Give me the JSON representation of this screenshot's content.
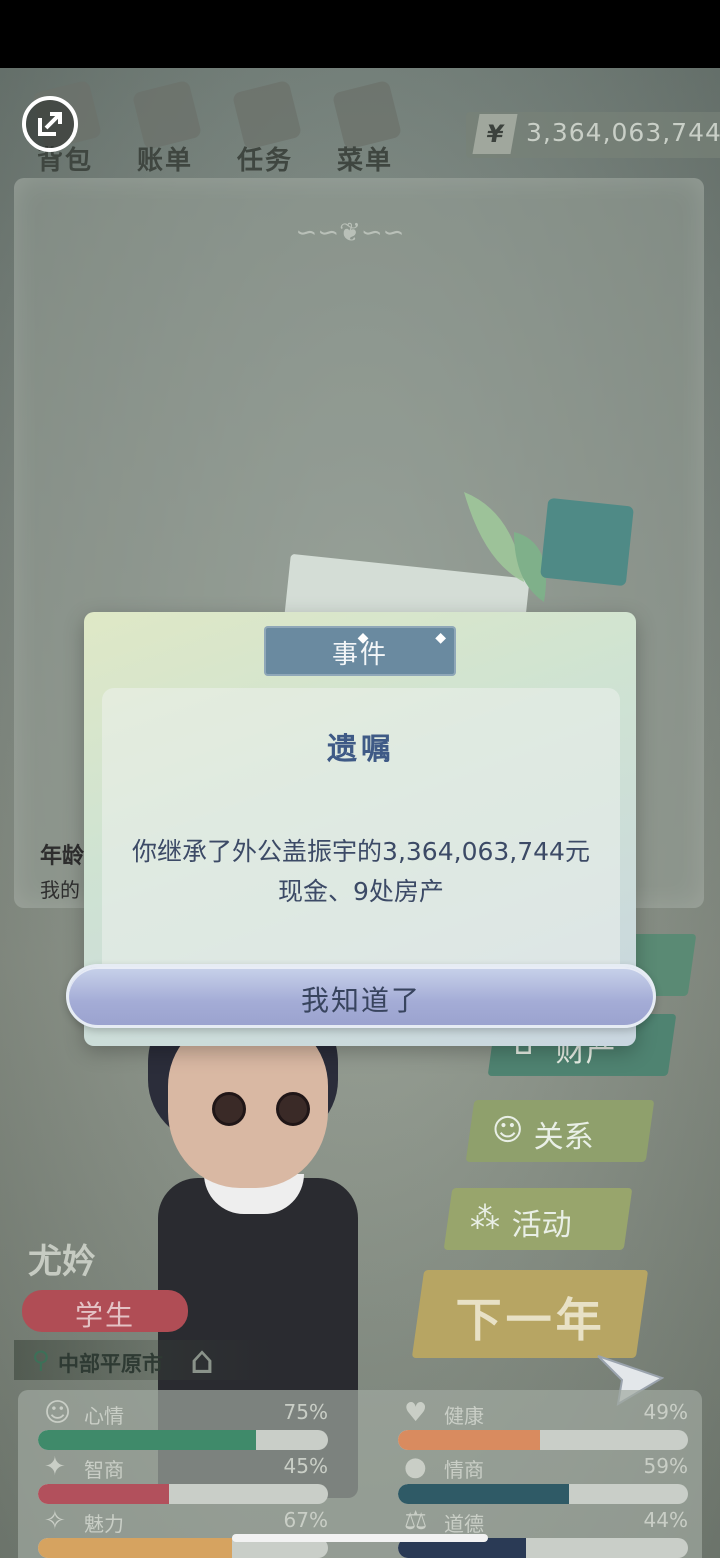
{
  "topbar": {
    "nav": [
      "背包",
      "账单",
      "任务",
      "菜单"
    ],
    "money_symbol": "¥",
    "money": "3,364,063,744"
  },
  "log": {
    "age_label": "年龄",
    "line": "我的"
  },
  "side_menu": {
    "property": "财产",
    "relations": "关系",
    "activities": "活动",
    "next_year": "下一年"
  },
  "character": {
    "name": "尤妗",
    "role": "学生",
    "location": "中部平原市"
  },
  "stats": [
    {
      "icon": "smile-icon",
      "label": "心情",
      "value": "75%",
      "level": 0.75,
      "color": "#3f8a6a"
    },
    {
      "icon": "heart-icon",
      "label": "健康",
      "value": "49%",
      "level": 0.49,
      "color": "#d98b5f"
    },
    {
      "icon": "bulb-icon",
      "label": "智商",
      "value": "45%",
      "level": 0.45,
      "color": "#b2505c"
    },
    {
      "icon": "apple-icon",
      "label": "情商",
      "value": "59%",
      "level": 0.59,
      "color": "#2f5a66"
    },
    {
      "icon": "sparkle-icon",
      "label": "魅力",
      "value": "67%",
      "level": 0.67,
      "color": "#d6a360"
    },
    {
      "icon": "scale-icon",
      "label": "道德",
      "value": "44%",
      "level": 0.44,
      "color": "#2a3a55"
    }
  ],
  "modal": {
    "header": "事件",
    "title": "遗嘱",
    "body_line1": "你继承了外公盖振宇的3,364,063,744元",
    "body_line2": "现金、9处房产",
    "confirm": "我知道了"
  }
}
